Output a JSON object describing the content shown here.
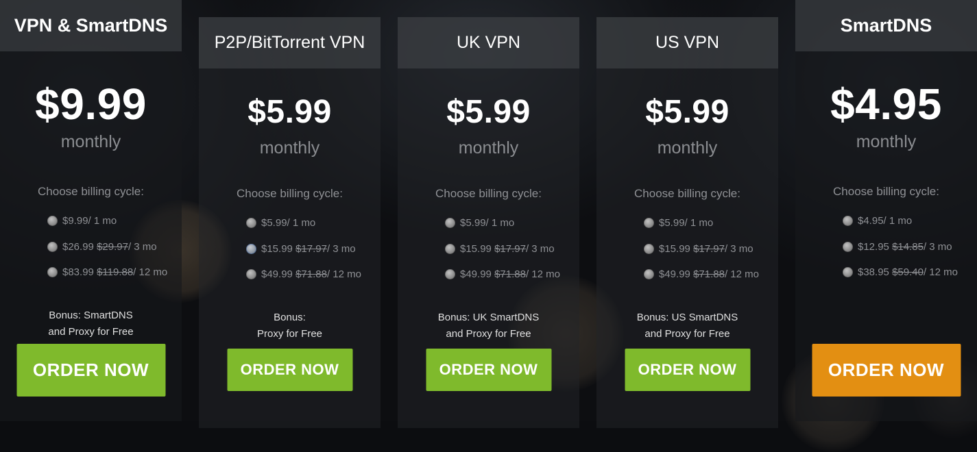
{
  "plans": [
    {
      "title": "VPN & SmartDNS",
      "price": "$9.99",
      "period": "monthly",
      "cycle_label": "Choose billing cycle:",
      "options": [
        {
          "price": "$9.99",
          "old": "",
          "term": " / 1 mo"
        },
        {
          "price": "$26.99",
          "old": "$29.97",
          "term": " / 3 mo"
        },
        {
          "price": "$83.99",
          "old": "$119.88",
          "term": " / 12 mo"
        }
      ],
      "bonus_line1": "Bonus: SmartDNS",
      "bonus_line2": "and Proxy for Free",
      "button": "ORDER NOW",
      "button_color": "#7fba2c"
    },
    {
      "title": "P2P/BitTorrent VPN",
      "price": "$5.99",
      "period": "monthly",
      "cycle_label": "Choose billing cycle:",
      "options": [
        {
          "price": "$5.99",
          "old": "",
          "term": " / 1 mo"
        },
        {
          "price": "$15.99",
          "old": "$17.97",
          "term": " / 3 mo"
        },
        {
          "price": "$49.99",
          "old": "$71.88",
          "term": " / 12 mo"
        }
      ],
      "bonus_line1": "Bonus:",
      "bonus_line2": "Proxy for Free",
      "button": "ORDER NOW",
      "button_color": "#7fba2c"
    },
    {
      "title": "UK VPN",
      "price": "$5.99",
      "period": "monthly",
      "cycle_label": "Choose billing cycle:",
      "options": [
        {
          "price": "$5.99",
          "old": "",
          "term": " / 1 mo"
        },
        {
          "price": "$15.99",
          "old": "$17.97",
          "term": " / 3 mo"
        },
        {
          "price": "$49.99",
          "old": "$71.88",
          "term": " / 12 mo"
        }
      ],
      "bonus_line1": "Bonus: UK SmartDNS",
      "bonus_line2": "and Proxy for Free",
      "button": "ORDER NOW",
      "button_color": "#7fba2c"
    },
    {
      "title": "US VPN",
      "price": "$5.99",
      "period": "monthly",
      "cycle_label": "Choose billing cycle:",
      "options": [
        {
          "price": "$5.99",
          "old": "",
          "term": " / 1 mo"
        },
        {
          "price": "$15.99",
          "old": "$17.97",
          "term": " / 3 mo"
        },
        {
          "price": "$49.99",
          "old": "$71.88",
          "term": " / 12 mo"
        }
      ],
      "bonus_line1": "Bonus: US SmartDNS",
      "bonus_line2": "and Proxy for Free",
      "button": "ORDER NOW",
      "button_color": "#7fba2c"
    },
    {
      "title": "SmartDNS",
      "price": "$4.95",
      "period": "monthly",
      "cycle_label": "Choose billing cycle:",
      "options": [
        {
          "price": "$4.95",
          "old": "",
          "term": " / 1 mo"
        },
        {
          "price": "$12.95",
          "old": "$14.85",
          "term": " / 3 mo"
        },
        {
          "price": "$38.95",
          "old": "$59.40",
          "term": " / 12 mo"
        }
      ],
      "bonus_line1": "",
      "bonus_line2": "",
      "button": "ORDER NOW",
      "button_color": "#e38f12"
    }
  ]
}
